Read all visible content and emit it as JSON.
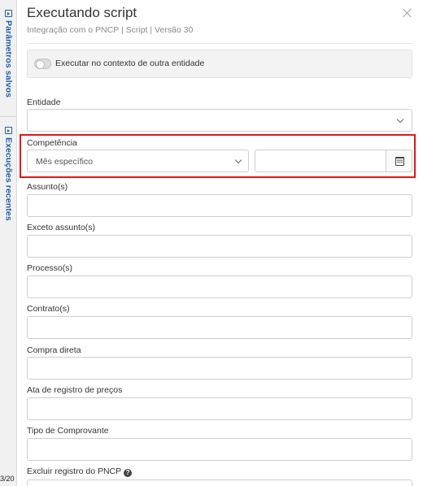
{
  "sidebar": {
    "tabs": [
      {
        "label": "Parâmetros salvos"
      },
      {
        "label": "Execuções recentes"
      }
    ],
    "bottom_text": "3/20"
  },
  "modal": {
    "title": "Executando script",
    "subtitle": "Integração com o PNCP | Script | Versão 30",
    "context_toggle_label": "Executar no contexto de outra entidade"
  },
  "fields": {
    "entidade": {
      "label": "Entidade",
      "value": ""
    },
    "competencia": {
      "label": "Competência",
      "type_value": "Mês específico",
      "date_value": ""
    },
    "assuntos": {
      "label": "Assunto(s)",
      "value": ""
    },
    "exceto_assuntos": {
      "label": "Exceto assunto(s)",
      "value": ""
    },
    "processos": {
      "label": "Processo(s)",
      "value": ""
    },
    "contratos": {
      "label": "Contrato(s)",
      "value": ""
    },
    "compra_direta": {
      "label": "Compra direta",
      "value": ""
    },
    "ata_registro": {
      "label": "Ata de registro de preços",
      "value": ""
    },
    "tipo_comprovante": {
      "label": "Tipo de Comprovante",
      "value": ""
    },
    "excluir_registro": {
      "label": "Excluir registro do PNCP",
      "help_icon": "?"
    }
  },
  "colors": {
    "accent": "#1f5ea8",
    "highlight": "#e0191b"
  }
}
